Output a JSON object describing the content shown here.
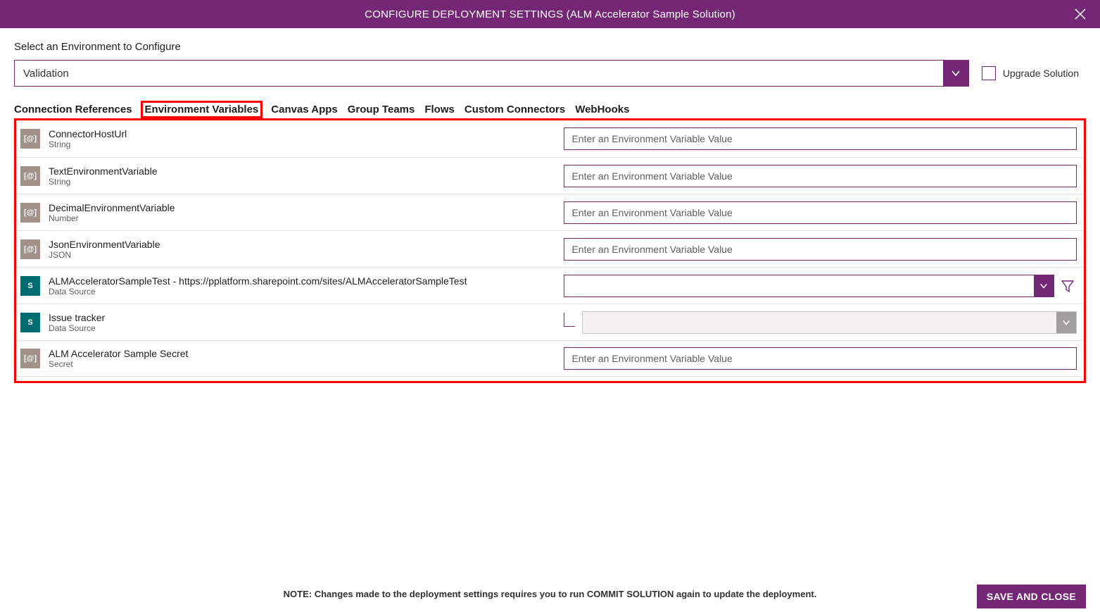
{
  "header": {
    "title": "CONFIGURE DEPLOYMENT SETTINGS (ALM Accelerator Sample Solution)"
  },
  "section": {
    "select_label": "Select an Environment to Configure",
    "selected_environment": "Validation",
    "upgrade_label": "Upgrade Solution"
  },
  "tabs": [
    {
      "id": "conn",
      "label": "Connection References",
      "active": false
    },
    {
      "id": "env",
      "label": "Environment Variables",
      "active": true
    },
    {
      "id": "apps",
      "label": "Canvas Apps",
      "active": false
    },
    {
      "id": "grp",
      "label": "Group Teams",
      "active": false
    },
    {
      "id": "flow",
      "label": "Flows",
      "active": false
    },
    {
      "id": "cc",
      "label": "Custom Connectors",
      "active": false
    },
    {
      "id": "wh",
      "label": "WebHooks",
      "active": false
    }
  ],
  "vars": [
    {
      "name": "ConnectorHostUrl",
      "type": "String",
      "input": "text",
      "placeholder": "Enter an Environment Variable Value",
      "icon": "env"
    },
    {
      "name": "TextEnvironmentVariable",
      "type": "String",
      "input": "text",
      "placeholder": "Enter an Environment Variable Value",
      "icon": "env"
    },
    {
      "name": "DecimalEnvironmentVariable",
      "type": "Number",
      "input": "text",
      "placeholder": "Enter an Environment Variable Value",
      "icon": "env"
    },
    {
      "name": "JsonEnvironmentVariable",
      "type": "JSON",
      "input": "text",
      "placeholder": "Enter an Environment Variable Value",
      "icon": "env"
    },
    {
      "name": "ALMAcceleratorSampleTest - https://pplatform.sharepoint.com/sites/ALMAcceleratorSampleTest",
      "type": "Data Source",
      "input": "dropdown-filter",
      "icon": "sp"
    },
    {
      "name": "Issue tracker",
      "type": "Data Source",
      "input": "dropdown-disabled-child",
      "icon": "sp"
    },
    {
      "name": "ALM Accelerator Sample Secret",
      "type": "Secret",
      "input": "text",
      "placeholder": "Enter an Environment Variable Value",
      "icon": "env"
    }
  ],
  "footer": {
    "note": "NOTE: Changes made to the deployment settings requires you to run COMMIT SOLUTION again to update the deployment.",
    "save_label": "SAVE AND CLOSE"
  },
  "icons": {
    "env_glyph": "[@]",
    "sp_glyph": "S"
  }
}
